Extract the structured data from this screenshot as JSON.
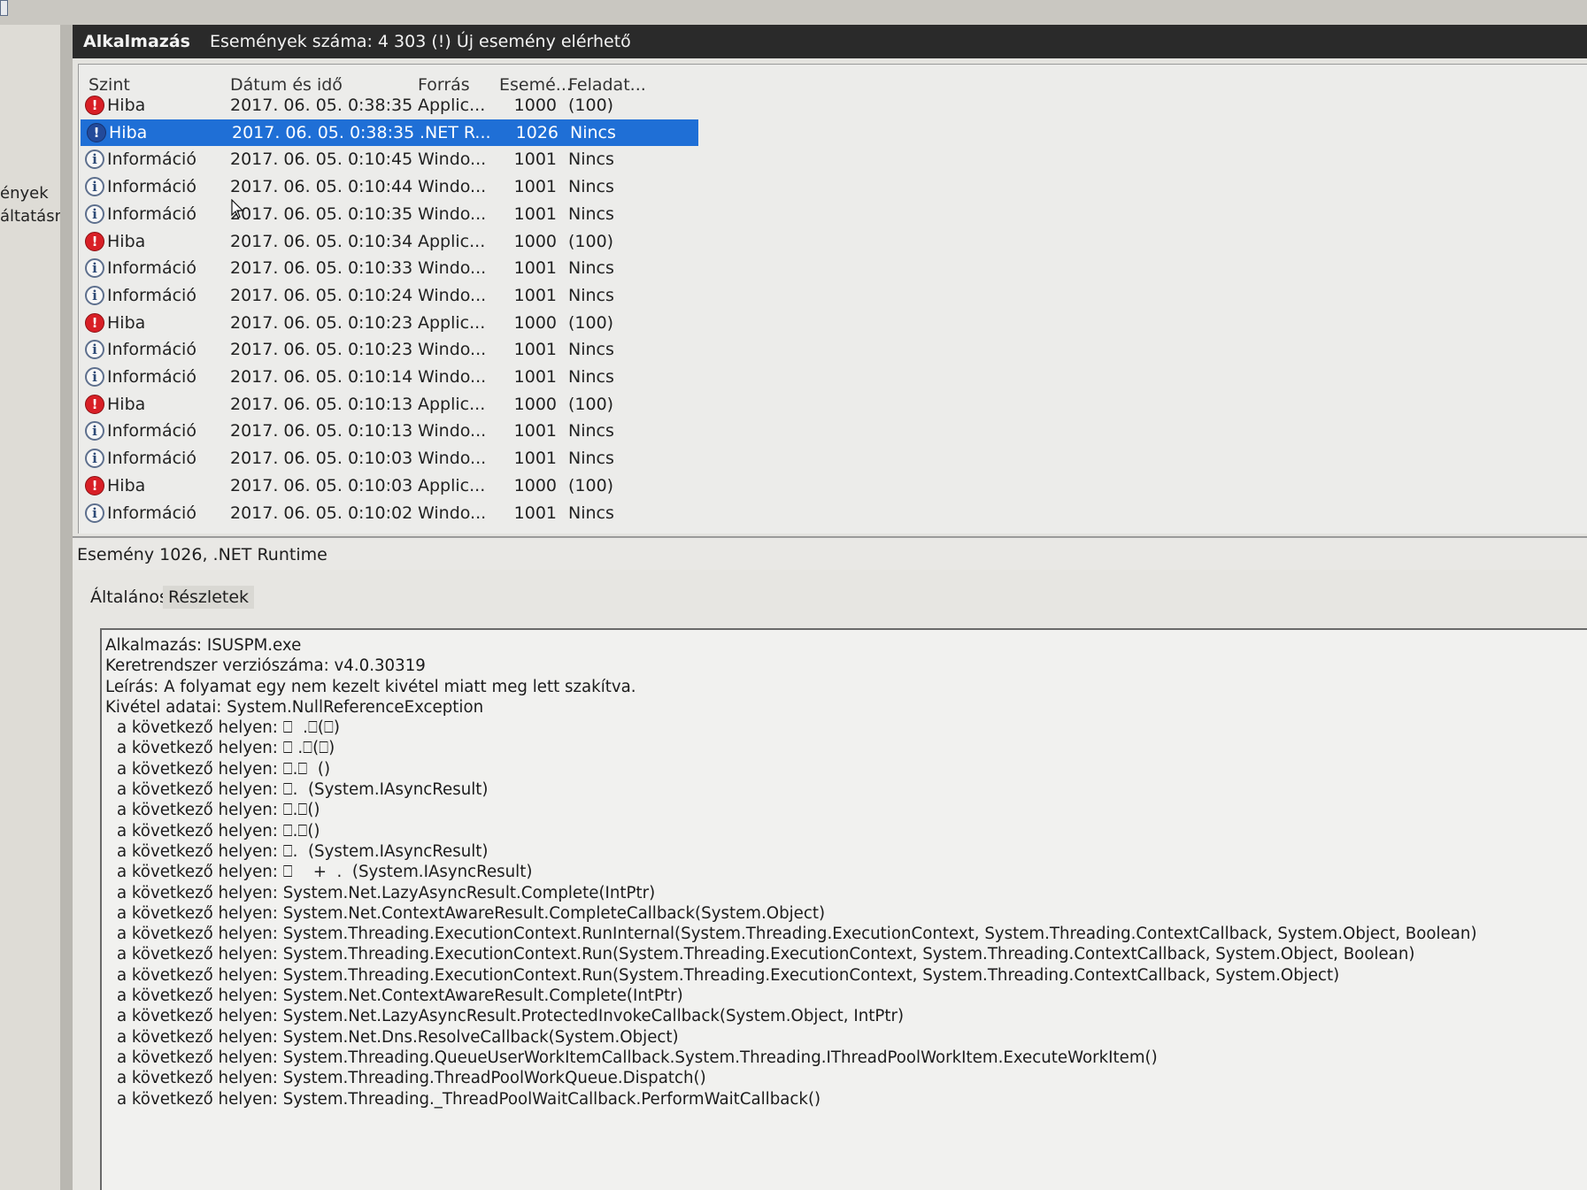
{
  "left_pane": {
    "items": [
      "ények",
      "áltatásn"
    ]
  },
  "header": {
    "title": "Alkalmazás",
    "subtitle": "Események száma: 4 303 (!) Új esemény elérhető"
  },
  "grid": {
    "columns": [
      "Szint",
      "Dátum és idő",
      "Forrás",
      "Esemé...",
      "Feladat..."
    ],
    "rows": [
      {
        "level": "Hiba",
        "type": "error",
        "date": "2017. 06. 05. 0:38:35",
        "source": "Applic...",
        "id": "1000",
        "task": "(100)",
        "selected": false
      },
      {
        "level": "Hiba",
        "type": "error",
        "date": "2017. 06. 05. 0:38:35",
        "source": ".NET R...",
        "id": "1026",
        "task": "Nincs",
        "selected": true
      },
      {
        "level": "Információ",
        "type": "info",
        "date": "2017. 06. 05. 0:10:45",
        "source": "Windo...",
        "id": "1001",
        "task": "Nincs",
        "selected": false
      },
      {
        "level": "Információ",
        "type": "info",
        "date": "2017. 06. 05. 0:10:44",
        "source": "Windo...",
        "id": "1001",
        "task": "Nincs",
        "selected": false
      },
      {
        "level": "Információ",
        "type": "info",
        "date": "2017. 06. 05. 0:10:35",
        "source": "Windo...",
        "id": "1001",
        "task": "Nincs",
        "selected": false
      },
      {
        "level": "Hiba",
        "type": "error",
        "date": "2017. 06. 05. 0:10:34",
        "source": "Applic...",
        "id": "1000",
        "task": "(100)",
        "selected": false
      },
      {
        "level": "Információ",
        "type": "info",
        "date": "2017. 06. 05. 0:10:33",
        "source": "Windo...",
        "id": "1001",
        "task": "Nincs",
        "selected": false
      },
      {
        "level": "Információ",
        "type": "info",
        "date": "2017. 06. 05. 0:10:24",
        "source": "Windo...",
        "id": "1001",
        "task": "Nincs",
        "selected": false
      },
      {
        "level": "Hiba",
        "type": "error",
        "date": "2017. 06. 05. 0:10:23",
        "source": "Applic...",
        "id": "1000",
        "task": "(100)",
        "selected": false
      },
      {
        "level": "Információ",
        "type": "info",
        "date": "2017. 06. 05. 0:10:23",
        "source": "Windo...",
        "id": "1001",
        "task": "Nincs",
        "selected": false
      },
      {
        "level": "Információ",
        "type": "info",
        "date": "2017. 06. 05. 0:10:14",
        "source": "Windo...",
        "id": "1001",
        "task": "Nincs",
        "selected": false
      },
      {
        "level": "Hiba",
        "type": "error",
        "date": "2017. 06. 05. 0:10:13",
        "source": "Applic...",
        "id": "1000",
        "task": "(100)",
        "selected": false
      },
      {
        "level": "Információ",
        "type": "info",
        "date": "2017. 06. 05. 0:10:13",
        "source": "Windo...",
        "id": "1001",
        "task": "Nincs",
        "selected": false
      },
      {
        "level": "Információ",
        "type": "info",
        "date": "2017. 06. 05. 0:10:03",
        "source": "Windo...",
        "id": "1001",
        "task": "Nincs",
        "selected": false
      },
      {
        "level": "Hiba",
        "type": "error",
        "date": "2017. 06. 05. 0:10:03",
        "source": "Applic...",
        "id": "1000",
        "task": "(100)",
        "selected": false
      },
      {
        "level": "Információ",
        "type": "info",
        "date": "2017. 06. 05. 0:10:02",
        "source": "Windo...",
        "id": "1001",
        "task": "Nincs",
        "selected": false
      }
    ]
  },
  "detail": {
    "title": "Esemény 1026, .NET Runtime",
    "tabs": [
      "Általános",
      "Részletek"
    ],
    "lines": [
      {
        "text": "Alkalmazás: ISUSPM.exe",
        "indent": false
      },
      {
        "text": "Keretrendszer verziószáma: v4.0.30319",
        "indent": false
      },
      {
        "text": "Leírás: A folyamat egy nem kezelt kivétel miatt meg lett szakítva.",
        "indent": false
      },
      {
        "text": "Kivétel adatai: System.NullReferenceException",
        "indent": false
      },
      {
        "text": "a következő helyen: ⎕  .⎕(⎕)",
        "indent": true
      },
      {
        "text": "a következő helyen: ⎕ .⎕(⎕)",
        "indent": true
      },
      {
        "text": "a következő helyen: ⎕.⎕  ()",
        "indent": true
      },
      {
        "text": "a következő helyen: ⎕.  (System.IAsyncResult)",
        "indent": true
      },
      {
        "text": "a következő helyen: ⎕.⎕()",
        "indent": true
      },
      {
        "text": "a következő helyen: ⎕.⎕()",
        "indent": true
      },
      {
        "text": "a következő helyen: ⎕.  (System.IAsyncResult)",
        "indent": true
      },
      {
        "text": "a következő helyen: ⎕    +  .  (System.IAsyncResult)",
        "indent": true
      },
      {
        "text": "a következő helyen: System.Net.LazyAsyncResult.Complete(IntPtr)",
        "indent": true
      },
      {
        "text": "a következő helyen: System.Net.ContextAwareResult.CompleteCallback(System.Object)",
        "indent": true
      },
      {
        "text": "a következő helyen: System.Threading.ExecutionContext.RunInternal(System.Threading.ExecutionContext, System.Threading.ContextCallback, System.Object, Boolean)",
        "indent": true
      },
      {
        "text": "a következő helyen: System.Threading.ExecutionContext.Run(System.Threading.ExecutionContext, System.Threading.ContextCallback, System.Object, Boolean)",
        "indent": true
      },
      {
        "text": "a következő helyen: System.Threading.ExecutionContext.Run(System.Threading.ExecutionContext, System.Threading.ContextCallback, System.Object)",
        "indent": true
      },
      {
        "text": "a következő helyen: System.Net.ContextAwareResult.Complete(IntPtr)",
        "indent": true
      },
      {
        "text": "a következő helyen: System.Net.LazyAsyncResult.ProtectedInvokeCallback(System.Object, IntPtr)",
        "indent": true
      },
      {
        "text": "a következő helyen: System.Net.Dns.ResolveCallback(System.Object)",
        "indent": true
      },
      {
        "text": "a következő helyen: System.Threading.QueueUserWorkItemCallback.System.Threading.IThreadPoolWorkItem.ExecuteWorkItem()",
        "indent": true
      },
      {
        "text": "a következő helyen: System.Threading.ThreadPoolWorkQueue.Dispatch()",
        "indent": true
      },
      {
        "text": "a következő helyen: System.Threading._ThreadPoolWaitCallback.PerformWaitCallback()",
        "indent": true
      }
    ]
  },
  "icons": {
    "error": "error-icon",
    "info": "info-icon"
  },
  "colors": {
    "selection": "#1f6fd6",
    "header_bar": "#2a2a2a",
    "error_icon": "#d81f26",
    "info_icon_border": "#5d6f8d"
  }
}
